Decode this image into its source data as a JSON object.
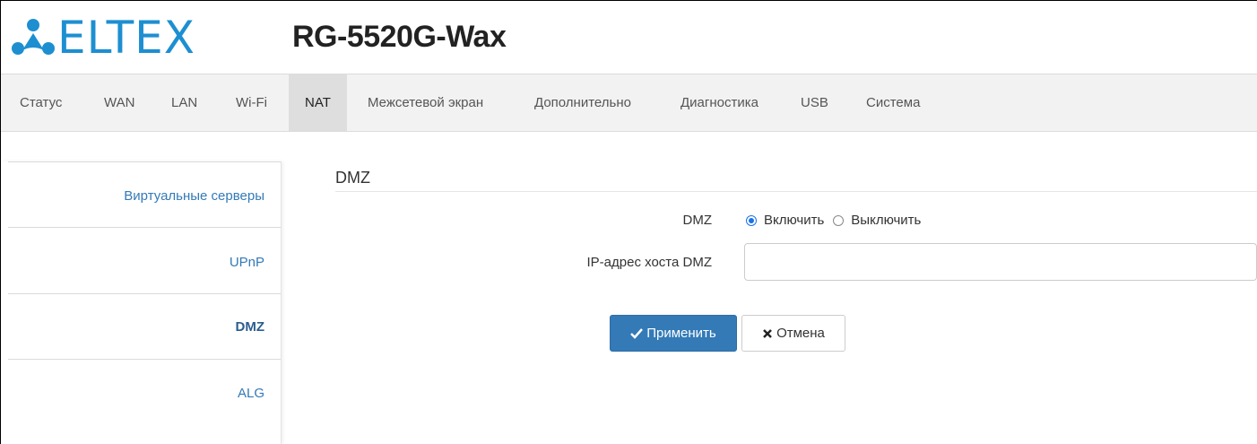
{
  "header": {
    "logo_text": "ELTEX",
    "model": "RG-5520G-Wax",
    "brand_color": "#1d8fd1"
  },
  "nav": {
    "items": [
      {
        "label": "Статус"
      },
      {
        "label": "WAN"
      },
      {
        "label": "LAN"
      },
      {
        "label": "Wi-Fi"
      },
      {
        "label": "NAT",
        "active": true
      },
      {
        "label": "Межсетевой экран"
      },
      {
        "label": "Дополнительно"
      },
      {
        "label": "Диагностика"
      },
      {
        "label": "USB"
      },
      {
        "label": "Система"
      }
    ]
  },
  "sidebar": {
    "items": [
      {
        "label": "Виртуальные серверы"
      },
      {
        "label": "UPnP"
      },
      {
        "label": "DMZ",
        "active": true
      },
      {
        "label": "ALG"
      }
    ]
  },
  "main": {
    "section_title": "DMZ",
    "dmz_label": "DMZ",
    "dmz_enable_label": "Включить",
    "dmz_disable_label": "Выключить",
    "dmz_selected": "Включить",
    "ip_label": "IP-адрес хоста DMZ",
    "ip_value": "",
    "ip_placeholder": "",
    "apply_label": "Применить",
    "cancel_label": "Отмена",
    "accent_color": "#337ab7"
  }
}
